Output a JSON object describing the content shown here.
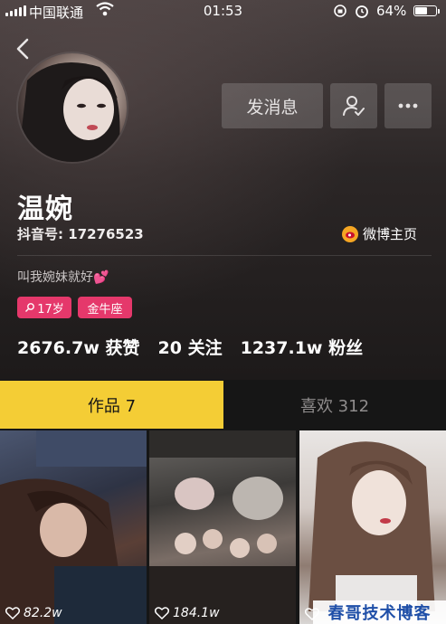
{
  "status_bar": {
    "carrier": "中国联通",
    "time": "01:53",
    "battery": "64%",
    "battery_level": 0.64
  },
  "header": {
    "message_button": "发消息"
  },
  "profile": {
    "name": "温婉",
    "douyin_id": "抖音号: 17276523",
    "weibo_link": "微博主页",
    "bio": "叫我婉妹就好",
    "bio_emoji": "💕",
    "tags": {
      "age": "17岁",
      "zodiac": "金牛座"
    }
  },
  "stats": {
    "likes_value": "2676.7w",
    "likes_label": "获赞",
    "following_value": "20",
    "following_label": "关注",
    "fans_value": "1237.1w",
    "fans_label": "粉丝"
  },
  "tabs": {
    "works": "作品 7",
    "likes": "喜欢 312"
  },
  "videos": [
    {
      "plays": "82.2w"
    },
    {
      "plays": "184.1w"
    },
    {
      "plays": ""
    }
  ],
  "watermark": "春哥技术博客",
  "colors": {
    "accent": "#f4cd35",
    "tag": "#e5386b",
    "background": "#161616"
  },
  "icons": [
    "back-icon",
    "user-check-icon",
    "more-icon",
    "weibo-icon",
    "heart-icon",
    "wifi-icon",
    "alarm-icon",
    "rotation-lock-icon"
  ]
}
